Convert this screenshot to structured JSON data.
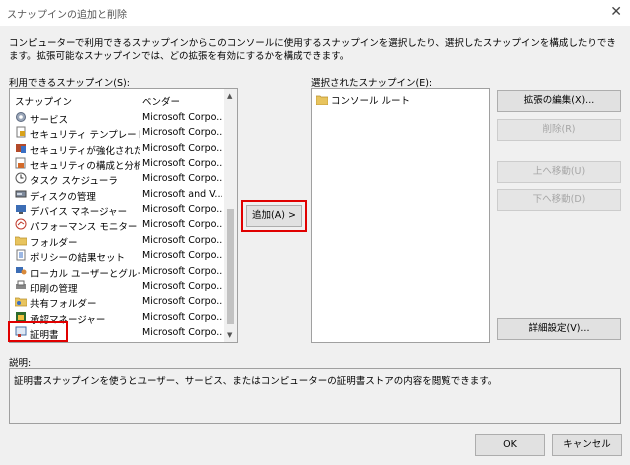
{
  "window": {
    "title": "スナップインの追加と削除",
    "close_glyph": "✕"
  },
  "description": "コンピューターで利用できるスナップインからこのコンソールに使用するスナップインを選択したり、選択したスナップインを構成したりできます。拡張可能なスナップインでは、どの拡張を有効にするかを構成できます。",
  "available": {
    "label": "利用できるスナップイン(S):",
    "col_name": "スナップイン",
    "col_vendor": "ベンダー",
    "items": [
      {
        "name": "サービス",
        "vendor": "Microsoft Corpo...",
        "icon": "services-icon"
      },
      {
        "name": "セキュリティ テンプレート",
        "vendor": "Microsoft Corpo...",
        "icon": "security-template-icon"
      },
      {
        "name": "セキュリティが強化された W...",
        "vendor": "Microsoft Corpo...",
        "icon": "firewall-icon"
      },
      {
        "name": "セキュリティの構成と分析",
        "vendor": "Microsoft Corpo...",
        "icon": "security-analysis-icon"
      },
      {
        "name": "タスク スケジューラ",
        "vendor": "Microsoft Corpo...",
        "icon": "clock-icon"
      },
      {
        "name": "ディスクの管理",
        "vendor": "Microsoft and V...",
        "icon": "disk-icon"
      },
      {
        "name": "デバイス マネージャー",
        "vendor": "Microsoft Corpo...",
        "icon": "device-manager-icon"
      },
      {
        "name": "パフォーマンス モニター",
        "vendor": "Microsoft Corpo...",
        "icon": "performance-icon"
      },
      {
        "name": "フォルダー",
        "vendor": "Microsoft Corpo...",
        "icon": "folder-icon"
      },
      {
        "name": "ポリシーの結果セット",
        "vendor": "Microsoft Corpo...",
        "icon": "policy-icon"
      },
      {
        "name": "ローカル ユーザーとグループ",
        "vendor": "Microsoft Corpo...",
        "icon": "users-icon"
      },
      {
        "name": "印刷の管理",
        "vendor": "Microsoft Corpo...",
        "icon": "printer-icon"
      },
      {
        "name": "共有フォルダー",
        "vendor": "Microsoft Corpo...",
        "icon": "shared-folder-icon"
      },
      {
        "name": "承認マネージャー",
        "vendor": "Microsoft Corpo...",
        "icon": "authorization-icon"
      },
      {
        "name": "証明書",
        "vendor": "Microsoft Corpo...",
        "icon": "certificate-icon"
      }
    ]
  },
  "selected": {
    "label": "選択されたスナップイン(E):",
    "root": "コンソール ルート"
  },
  "buttons": {
    "add": "追加(A) >",
    "edit_extensions": "拡張の編集(X)...",
    "remove": "削除(R)",
    "move_up": "上へ移動(U)",
    "move_down": "下へ移動(D)",
    "advanced": "詳細設定(V)...",
    "ok": "OK",
    "cancel": "キャンセル"
  },
  "desc_section": {
    "label": "説明:",
    "text": "証明書スナップインを使うとユーザー、サービス、またはコンピューターの証明書ストアの内容を閲覧できます。"
  },
  "colors": {
    "highlight": "#e00000"
  }
}
